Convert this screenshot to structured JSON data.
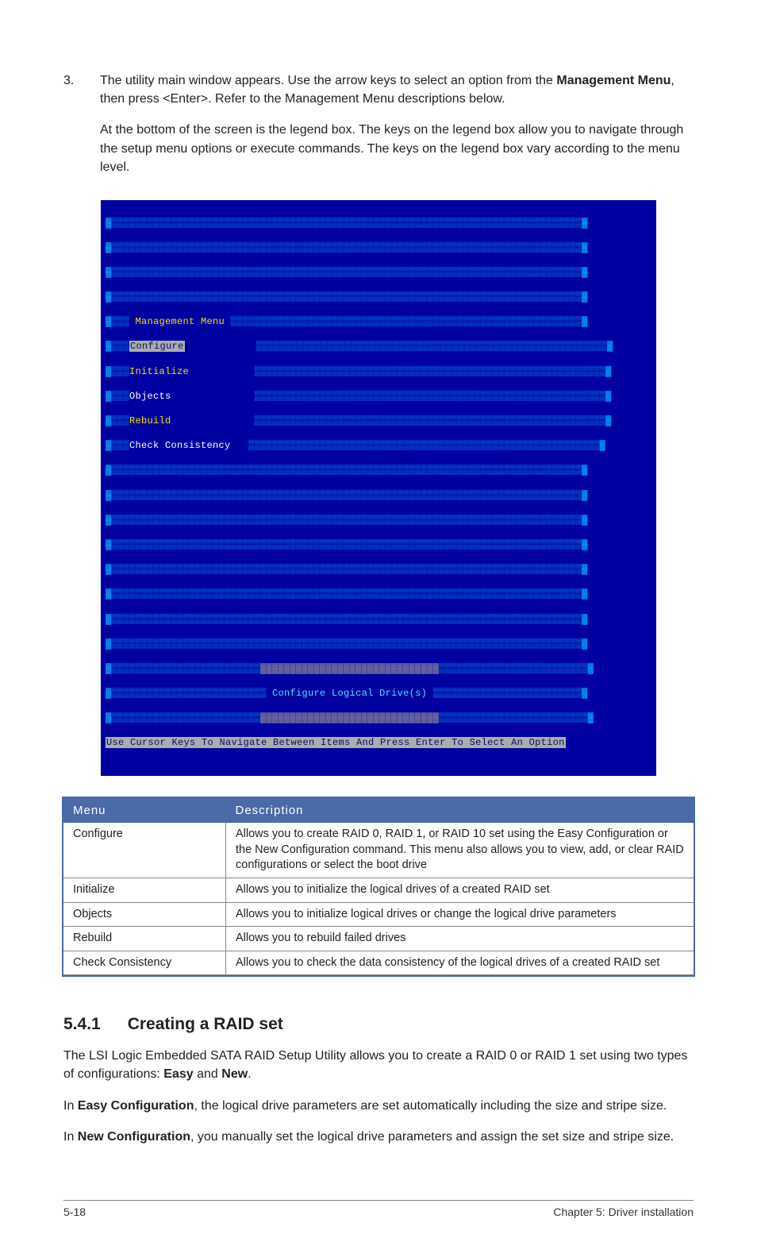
{
  "step": {
    "num": "3.",
    "p1_a": "The utility main window appears. Use the arrow keys to select an option from the ",
    "p1_b": "Management Menu",
    "p1_c": ", then press <Enter>. Refer to the Management Menu descriptions below.",
    "p2": "At the bottom of the screen is the legend box. The keys on the legend box allow you to navigate through the setup menu options or execute commands. The keys on the legend box vary according to the menu level."
  },
  "term": {
    "header": "Management Menu",
    "items": [
      "Configure",
      "Initialize",
      "Objects",
      "Rebuild",
      "Check Consistency"
    ],
    "hint": "Configure Logical Drive(s)",
    "legend": "Use Cursor Keys To Navigate Between Items And Press Enter To Select An Option"
  },
  "table": {
    "head_menu": "Menu",
    "head_desc": "Description",
    "rows": [
      {
        "m": "Configure",
        "d": "Allows you to create RAID 0, RAID 1, or RAID 10 set using the Easy Configuration or the New Configuration command. This menu also allows you to view, add, or clear RAID configurations or select the boot drive"
      },
      {
        "m": "Initialize",
        "d": "Allows you to initialize the logical drives of a created RAID set"
      },
      {
        "m": "Objects",
        "d": "Allows you to initialize logical drives or change the logical drive parameters"
      },
      {
        "m": "Rebuild",
        "d": "Allows you to rebuild failed drives"
      },
      {
        "m": "Check Consistency",
        "d": "Allows you to check the data consistency of the logical drives of a created RAID set"
      }
    ]
  },
  "section": {
    "num": "5.4.1",
    "title": "Creating a RAID set",
    "p1_a": "The LSI Logic Embedded SATA RAID Setup Utility allows you to create a RAID 0 or RAID 1 set using two types of configurations: ",
    "p1_b": "Easy",
    "p1_c": " and ",
    "p1_d": "New",
    "p1_e": ".",
    "p2_a": "In ",
    "p2_b": "Easy Configuration",
    "p2_c": ", the logical drive parameters are set automatically including the size and stripe size.",
    "p3_a": "In ",
    "p3_b": "New Configuration",
    "p3_c": ", you manually set the logical drive parameters and assign the set size and stripe size."
  },
  "footer": {
    "left": "5-18",
    "right": "Chapter 5: Driver installation"
  }
}
